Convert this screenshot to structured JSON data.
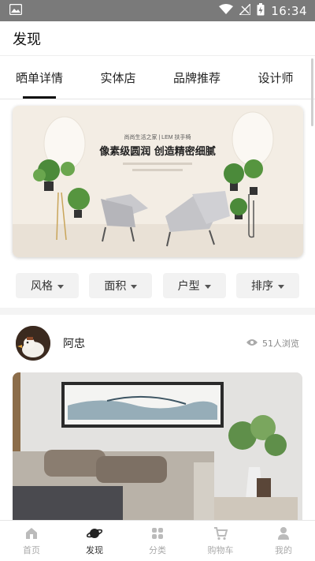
{
  "status_bar": {
    "time": "16:34"
  },
  "header": {
    "title": "发现"
  },
  "tabs": [
    {
      "label": "晒单详情",
      "active": true
    },
    {
      "label": "实体店",
      "active": false
    },
    {
      "label": "品牌推荐",
      "active": false
    },
    {
      "label": "设计师",
      "active": false
    }
  ],
  "banner": {
    "small_text": "尚尚生活之家 | LEM 扶手椅",
    "headline": "像素级圆润 创造精密细腻"
  },
  "filters": [
    {
      "label": "风格"
    },
    {
      "label": "面积"
    },
    {
      "label": "户型"
    },
    {
      "label": "排序"
    }
  ],
  "post": {
    "author": "阿忠",
    "views": "51人浏览"
  },
  "bottom_nav": [
    {
      "label": "首页",
      "icon": "home-icon",
      "active": false
    },
    {
      "label": "发现",
      "icon": "planet-icon",
      "active": true
    },
    {
      "label": "分类",
      "icon": "grid-icon",
      "active": false
    },
    {
      "label": "购物车",
      "icon": "cart-icon",
      "active": false
    },
    {
      "label": "我的",
      "icon": "person-icon",
      "active": false
    }
  ]
}
